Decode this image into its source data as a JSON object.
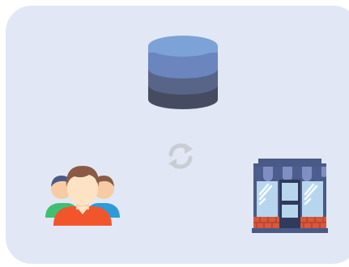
{
  "diagram": {
    "nodes": [
      {
        "id": "database",
        "icon": "database-icon"
      },
      {
        "id": "sync",
        "icon": "sync-icon"
      },
      {
        "id": "users",
        "icon": "users-group-icon"
      },
      {
        "id": "store",
        "icon": "storefront-icon"
      }
    ]
  },
  "colors": {
    "panel_background": "#e1e7f4",
    "database_top": "#7da2d8",
    "database_band_1": "#6b85bf",
    "database_band_2": "#586488",
    "database_band_3": "#454c61",
    "sync_gray": "#c9ccd2",
    "person_skin": "#fde3c3",
    "person_hair": "#8a5a44",
    "shirt_orange": "#f2552c",
    "shirt_green": "#3fbf74",
    "shirt_blue": "#2d9bd8",
    "store_frame": "#4a5a86",
    "store_awning_dark": "#4d5d8d",
    "store_awning_light": "#7f8fc4",
    "store_glass": "#b7d6ee",
    "store_brick": "#d7583c"
  }
}
